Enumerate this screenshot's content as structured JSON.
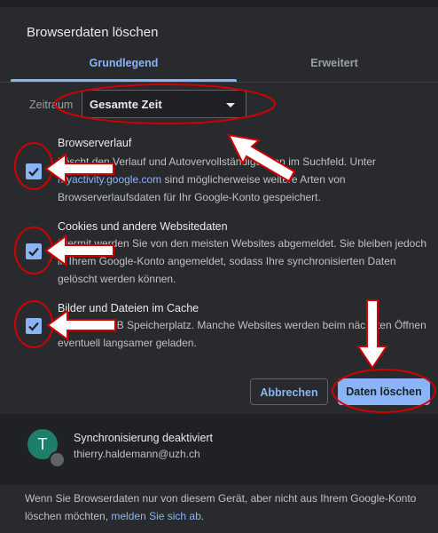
{
  "dialog": {
    "title": "Browserdaten löschen",
    "tabs": {
      "basic": "Grundlegend",
      "advanced": "Erweitert"
    },
    "time_range": {
      "label": "Zeitraum",
      "value": "Gesamte Zeit"
    }
  },
  "options": [
    {
      "title": "Browserverlauf",
      "desc_pre": "Löscht den Verlauf und Autovervollständigungen im Suchfeld. Unter ",
      "link": "myactivity.google.com",
      "desc_post": " sind möglicherweise weitere Arten von Browserverlaufsdaten für Ihr Google-Konto gespeichert.",
      "checked": true
    },
    {
      "title": "Cookies und andere Websitedaten",
      "desc": "Hiermit werden Sie von den meisten Websites abgemeldet. Sie bleiben jedoch in Ihrem Google-Konto angemeldet, sodass Ihre synchronisierten Daten gelöscht werden können.",
      "checked": true
    },
    {
      "title": "Bilder und Dateien im Cache",
      "desc": "Frei von 2 MB Speicherplatz. Manche Websites werden beim nächsten Öffnen eventuell langsamer geladen.",
      "checked": true
    }
  ],
  "buttons": {
    "cancel": "Abbrechen",
    "delete": "Daten löschen"
  },
  "sync": {
    "avatar_letter": "T",
    "title": "Synchronisierung deaktiviert",
    "email": "thierry.haldemann@uzh.ch"
  },
  "footer": {
    "text": "Wenn Sie Browserdaten nur von diesem Gerät, aber nicht aus Ihrem Google-Konto löschen möchten, ",
    "link": "melden Sie sich ab",
    "end": "."
  },
  "colors": {
    "accent": "#8ab4f8",
    "background": "#292a2d",
    "annotation_red": "#d00000",
    "arrow_fill": "#ffffff"
  }
}
